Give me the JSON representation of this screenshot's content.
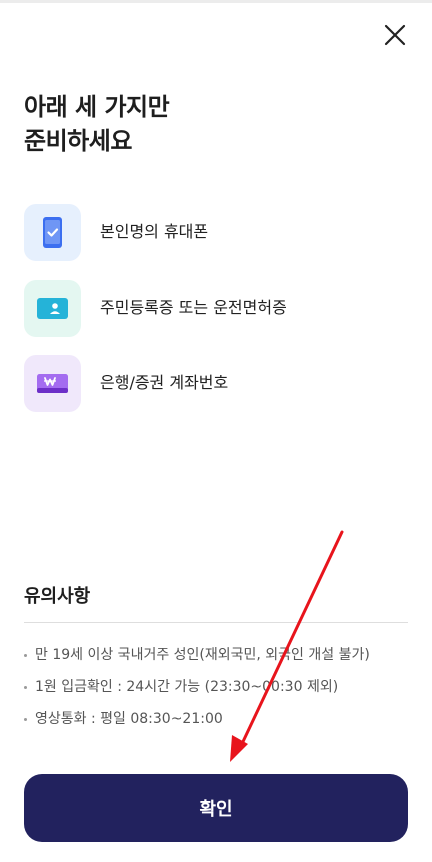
{
  "header": {
    "close_icon": "close-icon"
  },
  "title": {
    "line1": "아래 세 가지만",
    "line2": "준비하세요"
  },
  "requirements": [
    {
      "label": "본인명의 휴대폰",
      "icon": "smartphone-icon",
      "bg_color": "#e6f0fd",
      "accent": "#3c6ff0"
    },
    {
      "label": "주민등록증 또는 운전면허증",
      "icon": "id-card-icon",
      "bg_color": "#e4f7f1",
      "accent": "#25b3d8"
    },
    {
      "label": "은행/증권 계좌번호",
      "icon": "bank-card-icon",
      "bg_color": "#f0e8fb",
      "accent": "#8e44e6"
    }
  ],
  "notice": {
    "title": "유의사항",
    "items": [
      "만 19세 이상 국내거주 성인(재외국민, 외국인 개설 불가)",
      "1원 입금확인 : 24시간 가능 (23:30~00:30 제외)",
      "영상통화 : 평일 08:30~21:00"
    ]
  },
  "confirm_button": {
    "label": "확인",
    "bg_color": "#22225e"
  },
  "annotation": {
    "color": "#e8141c"
  }
}
